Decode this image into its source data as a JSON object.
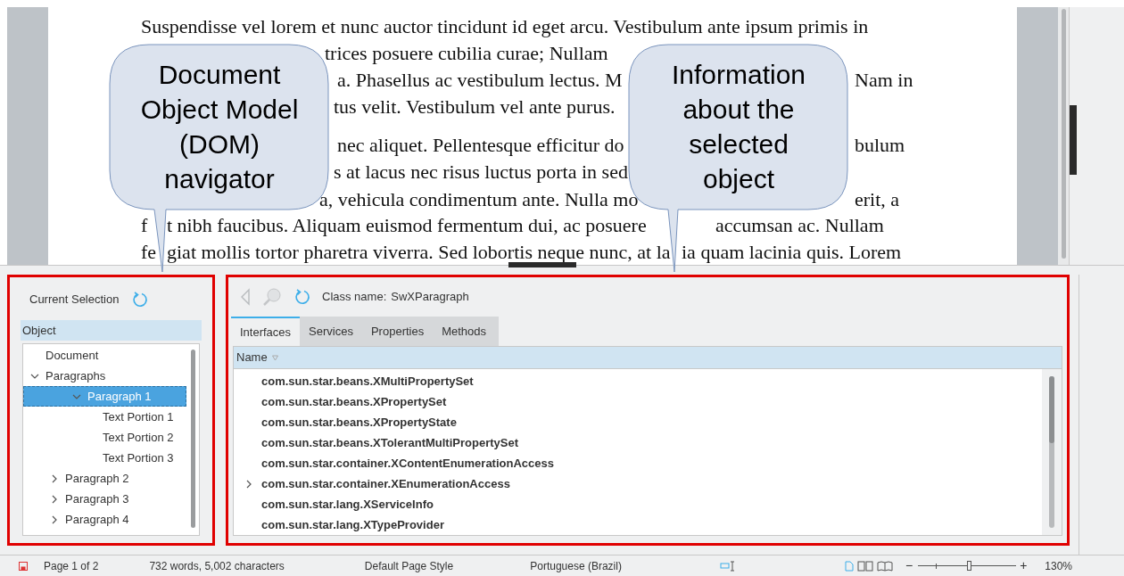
{
  "document": {
    "lines": [
      {
        "segments": [
          "Suspendisse vel lorem et nunc auctor tincidunt id eget arcu. Vestibulum ante ipsum primis in"
        ]
      },
      {
        "segments": [
          "trices posuere cubilia curae; Nullam"
        ]
      },
      {
        "segments": [
          "a. Phasellus ac vestibulum lectus. M",
          "Nam in"
        ]
      },
      {
        "segments": [
          "tus velit. Vestibulum vel ante purus."
        ]
      },
      {
        "segments": [
          "nec aliquet. Pellentesque efficitur do",
          "bulum"
        ]
      },
      {
        "segments": [
          "s at lacus nec risus luctus porta in sed"
        ]
      },
      {
        "segments": [
          "a, vehicula condimentum ante. Nulla mo",
          "erit, a"
        ]
      },
      {
        "segments": [
          "f",
          "t nibh faucibus. Aliquam euismod fermentum dui, ac posuere",
          "accumsan ac. Nullam"
        ]
      },
      {
        "segments": [
          "fe",
          "giat mollis tortor pharetra viverra. Sed lobortis neque nunc, at la",
          "ia quam lacinia quis. Lorem"
        ]
      }
    ]
  },
  "callouts": [
    {
      "text": "Document Object Model (DOM) navigator"
    },
    {
      "text": "Information about the selected object"
    }
  ],
  "navigator": {
    "header": "Current Selection",
    "column": "Object",
    "tree": [
      {
        "label": "Document",
        "selected": false
      },
      {
        "label": "Paragraphs",
        "selected": false,
        "expanded": true,
        "children": [
          {
            "label": "Paragraph 1",
            "selected": true,
            "expanded": true,
            "children": [
              {
                "label": "Text Portion 1",
                "selected": false
              },
              {
                "label": "Text Portion 2",
                "selected": false
              },
              {
                "label": "Text Portion 3",
                "selected": false
              }
            ]
          },
          {
            "label": "Paragraph 2",
            "selected": false,
            "expanded": false
          },
          {
            "label": "Paragraph 3",
            "selected": false,
            "expanded": false
          },
          {
            "label": "Paragraph 4",
            "selected": false,
            "expanded": false
          }
        ]
      }
    ]
  },
  "inspector": {
    "class_label": "Class name:",
    "class_name": "SwXParagraph",
    "tabs": [
      {
        "label": "Interfaces",
        "selected": true
      },
      {
        "label": "Services",
        "selected": false
      },
      {
        "label": "Properties",
        "selected": false
      },
      {
        "label": "Methods",
        "selected": false
      }
    ],
    "column": "Name",
    "rows": [
      {
        "name": "com.sun.star.beans.XMultiPropertySet",
        "expandable": false
      },
      {
        "name": "com.sun.star.beans.XPropertySet",
        "expandable": false
      },
      {
        "name": "com.sun.star.beans.XPropertyState",
        "expandable": false
      },
      {
        "name": "com.sun.star.beans.XTolerantMultiPropertySet",
        "expandable": false
      },
      {
        "name": "com.sun.star.container.XContentEnumerationAccess",
        "expandable": false
      },
      {
        "name": "com.sun.star.container.XEnumerationAccess",
        "expandable": true
      },
      {
        "name": "com.sun.star.lang.XServiceInfo",
        "expandable": false
      },
      {
        "name": "com.sun.star.lang.XTypeProvider",
        "expandable": false
      }
    ]
  },
  "status_bar": {
    "page": "Page 1 of 2",
    "words": "732 words, 5,002 characters",
    "page_style": "Default Page Style",
    "language": "Portuguese (Brazil)",
    "zoom_minus": "−",
    "zoom_plus": "+",
    "zoom": {
      "level": 0.53
    },
    "zoom_percent": "130%"
  }
}
